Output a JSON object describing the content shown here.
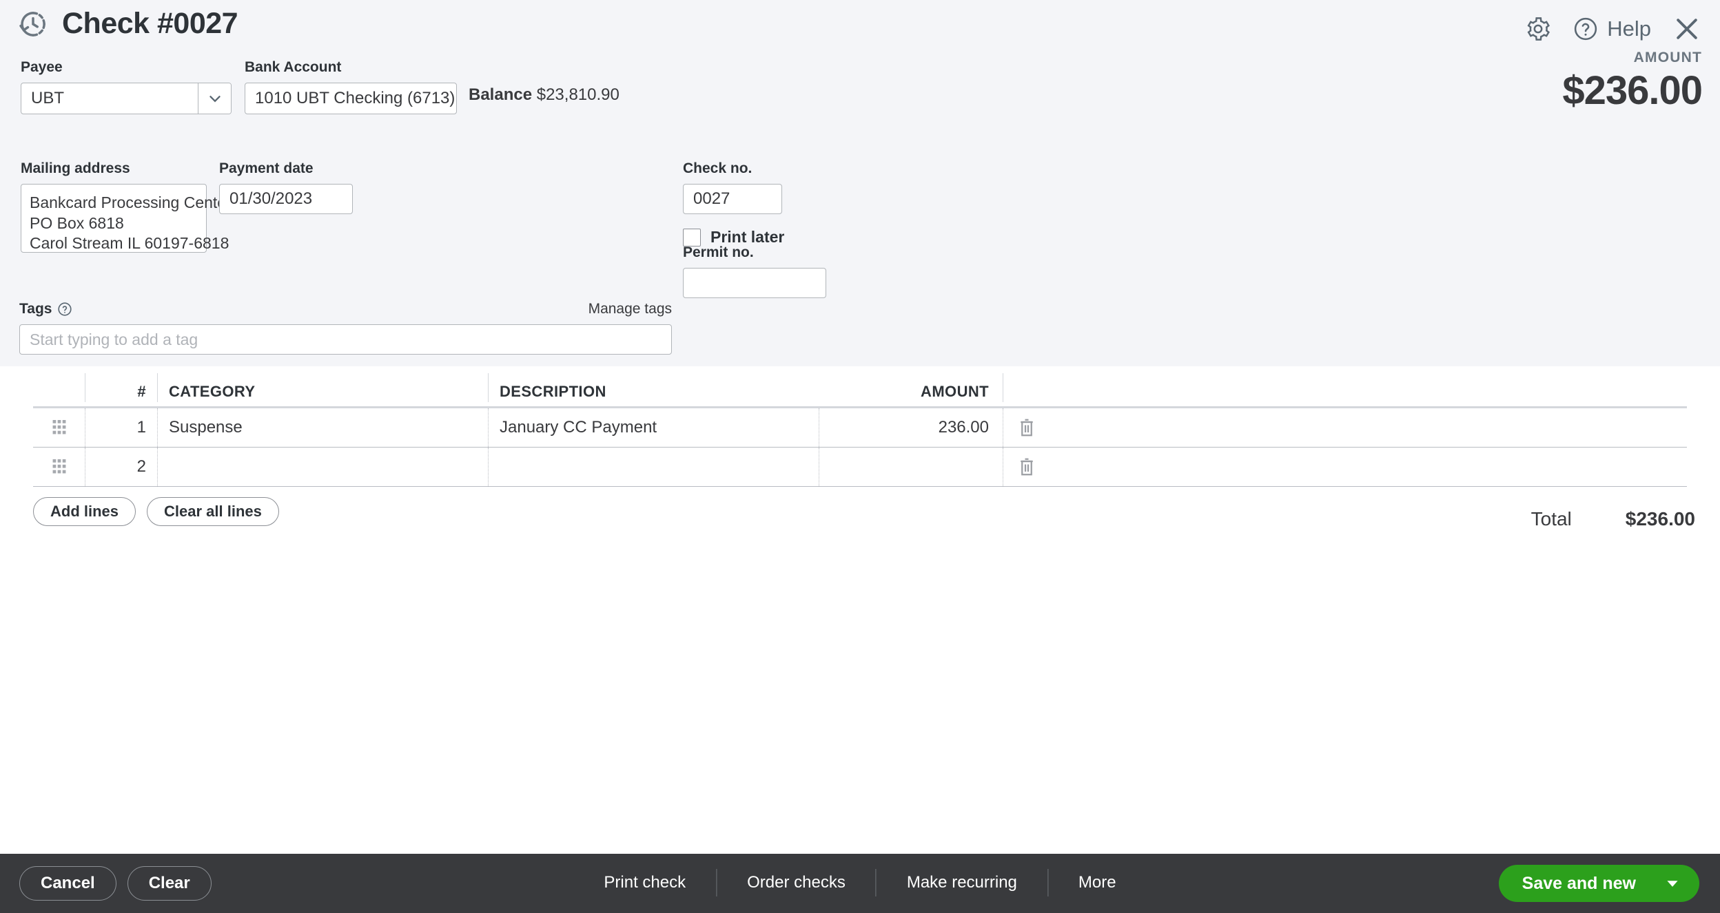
{
  "header": {
    "title": "Check #0027",
    "history_icon": "history-clock-icon",
    "gear_icon": "gear-icon",
    "help_icon": "question-circle-icon",
    "help_label": "Help",
    "close_icon": "close-x-icon"
  },
  "form": {
    "payee_label": "Payee",
    "payee_value": "UBT",
    "bank_label": "Bank Account",
    "bank_value": "1010 UBT Checking (6713)",
    "balance_label": "Balance",
    "balance_value": "$23,810.90",
    "amount_label": "AMOUNT",
    "amount_value": "$236.00",
    "mailing_label": "Mailing address",
    "mailing_lines": [
      "Bankcard Processing Center",
      "PO Box 6818",
      "Carol Stream IL 60197-6818"
    ],
    "payment_date_label": "Payment date",
    "payment_date_value": "01/30/2023",
    "check_no_label": "Check no.",
    "check_no_value": "0027",
    "print_later_label": "Print later",
    "print_later_checked": false,
    "permit_no_label": "Permit no.",
    "permit_no_value": ""
  },
  "tags": {
    "label": "Tags",
    "help_icon": "question-circle-small-icon",
    "manage_link": "Manage tags",
    "placeholder": "Start typing to add a tag"
  },
  "line_items": {
    "columns": [
      "#",
      "CATEGORY",
      "DESCRIPTION",
      "AMOUNT"
    ],
    "rows": [
      {
        "num": "1",
        "category": "Suspense",
        "description": "January CC Payment",
        "amount": "236.00",
        "delete_icon": "trash-icon",
        "handle_icon": "drag-handle-icon"
      },
      {
        "num": "2",
        "category": "",
        "description": "",
        "amount": "",
        "delete_icon": "trash-icon",
        "handle_icon": "drag-handle-icon"
      }
    ],
    "add_lines_label": "Add lines",
    "clear_all_lines_label": "Clear all lines",
    "total_label": "Total",
    "total_value": "$236.00"
  },
  "footer": {
    "cancel_label": "Cancel",
    "clear_label": "Clear",
    "print_check_label": "Print check",
    "order_checks_label": "Order checks",
    "make_recurring_label": "Make recurring",
    "more_label": "More",
    "save_label": "Save and new",
    "save_caret_icon": "caret-down-icon"
  },
  "colors": {
    "page_bg": "#f4f5f8",
    "text": "#393a3d",
    "footer_bg": "#393a3d",
    "save_green": "#2ca01c"
  }
}
